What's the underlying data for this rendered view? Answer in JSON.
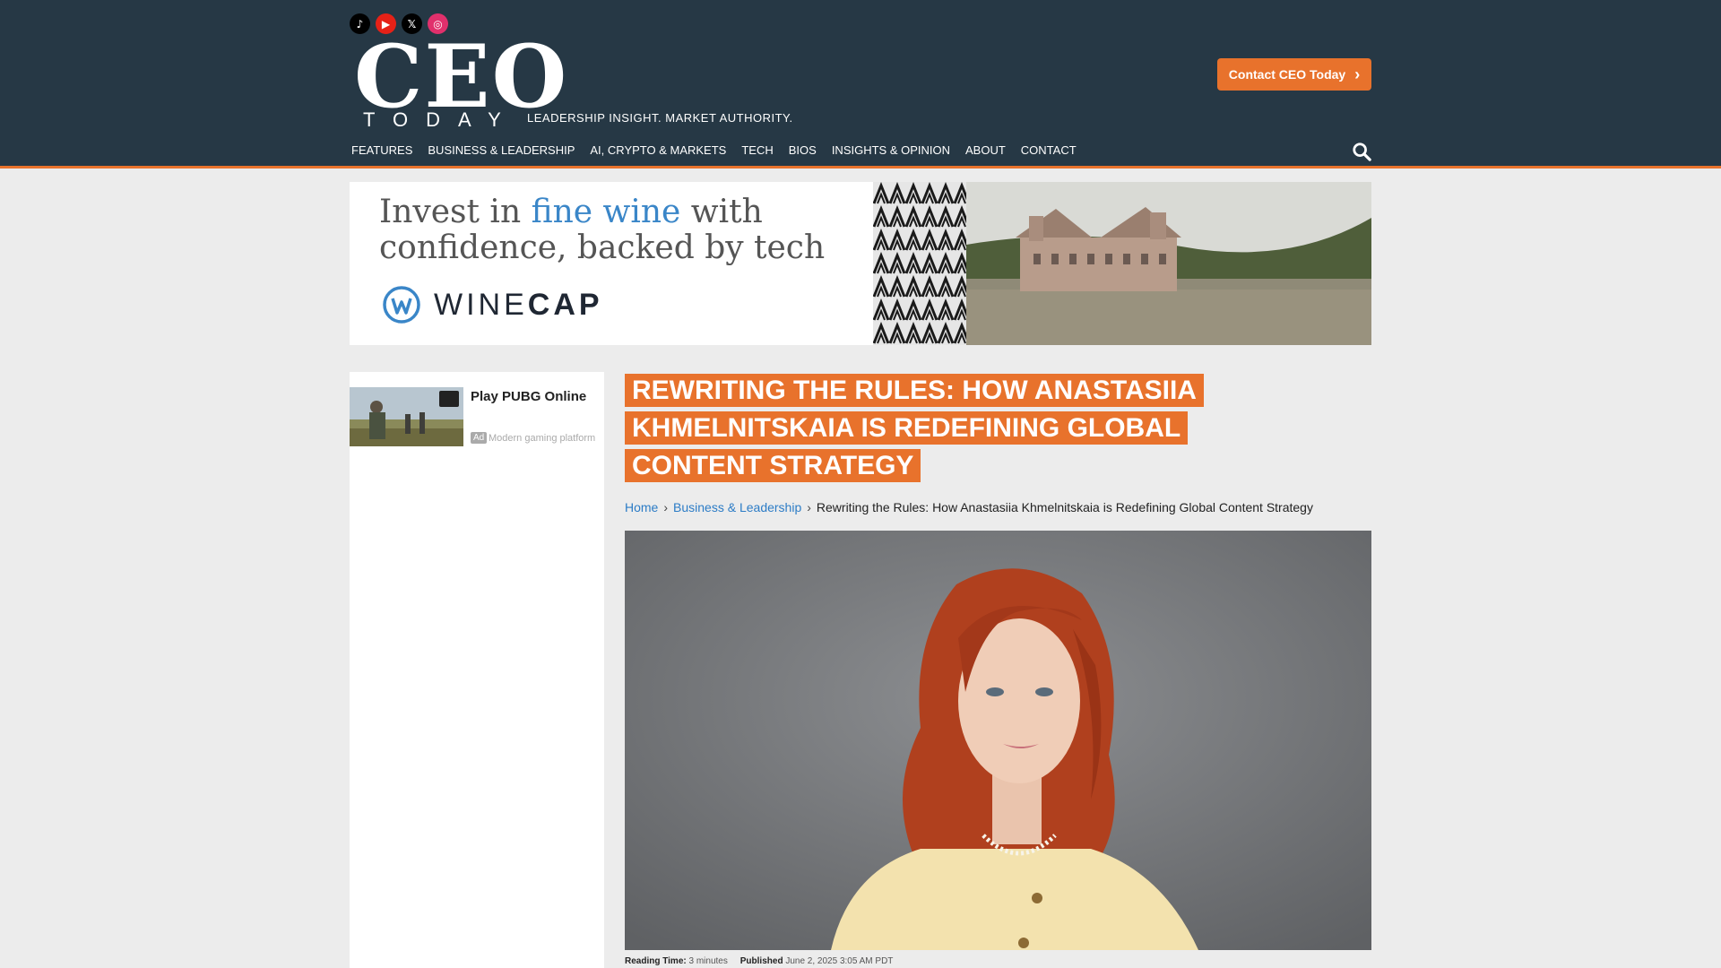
{
  "header": {
    "social": [
      {
        "name": "tiktok",
        "glyph": "♪"
      },
      {
        "name": "youtube",
        "glyph": "▶"
      },
      {
        "name": "x",
        "glyph": "𝕏"
      },
      {
        "name": "instagram",
        "glyph": "◎"
      }
    ],
    "logo_main": "CEO",
    "logo_sub": "TODAY",
    "tagline": "LEADERSHIP INSIGHT. MARKET AUTHORITY.",
    "contact_label": "Contact CEO Today",
    "contact_chevron": "›",
    "accent_color": "#e8722c",
    "header_color": "#263845"
  },
  "nav": {
    "items": [
      "FEATURES",
      "BUSINESS & LEADERSHIP",
      "AI, CRYPTO & MARKETS",
      "TECH",
      "BIOS",
      "INSIGHTS & OPINION",
      "ABOUT",
      "CONTACT"
    ],
    "search_icon": "search-icon"
  },
  "ad_banner": {
    "line1_prefix": "Invest in ",
    "line1_accent": "fine wine",
    "line1_suffix": " with",
    "line2": "confidence, backed by tech",
    "brand_light": "WINE",
    "brand_bold": "CAP"
  },
  "sidebar": {
    "ad_title": "Play PUBG Online",
    "ad_tag": "Ad",
    "ad_desc": "Modern gaming platform"
  },
  "article": {
    "title": "REWRITING THE RULES: HOW ANASTASIIA KHMELNITSKAIA IS REDEFINING GLOBAL CONTENT STRATEGY",
    "breadcrumb": {
      "home": "Home",
      "sep": "›",
      "category": "Business & Leadership",
      "current": "Rewriting the Rules: How Anastasiia Khmelnitskaia is Redefining Global Content Strategy"
    },
    "meta": {
      "reading_label": "Reading Time:",
      "reading_value": "3 minutes",
      "published_label": "Published",
      "published_value": "June 2, 2025 3:05 AM PDT"
    }
  }
}
